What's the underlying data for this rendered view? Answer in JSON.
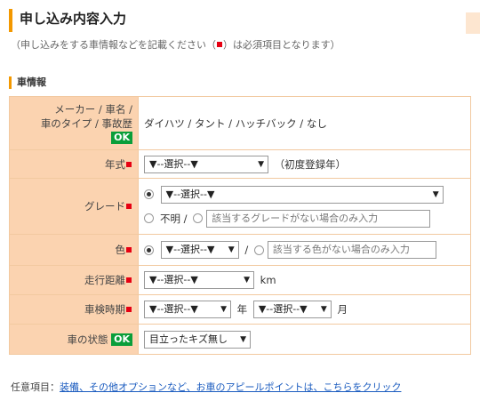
{
  "header": {
    "title": "申し込み内容入力",
    "subtitle_before": "（申し込みをする車情報などを記載ください（",
    "subtitle_after": "）は必須項目となります）"
  },
  "section": {
    "title": "車情報"
  },
  "rows": {
    "maker": {
      "label_line1": "メーカー / 車名 /",
      "label_line2": "車のタイプ / 事故歴",
      "ok": "OK",
      "value": "ダイハツ / タント / ハッチバック / なし"
    },
    "year": {
      "label": "年式",
      "select": "▼--選択--▼",
      "note": "（初度登録年）"
    },
    "grade": {
      "label": "グレード",
      "select": "▼--選択--▼",
      "unknown": "不明 /",
      "placeholder": "該当するグレードがない場合のみ入力"
    },
    "color": {
      "label": "色",
      "select": "▼--選択--▼",
      "slash": "/",
      "placeholder": "該当する色がない場合のみ入力"
    },
    "mileage": {
      "label": "走行距離",
      "select": "▼--選択--▼",
      "unit": "km"
    },
    "inspection": {
      "label": "車検時期",
      "year_select": "▼--選択--▼",
      "year_unit": "年",
      "month_select": "▼--選択--▼",
      "month_unit": "月"
    },
    "condition": {
      "label": "車の状態",
      "ok": "OK",
      "select": "目立ったキズ無し"
    }
  },
  "footer": {
    "prefix": "任意項目：",
    "link": "装備、その他オプションなど、お車のアピールポイントは、こちらをクリック"
  },
  "colors": {
    "label_bg": "#fbd3b0",
    "accent": "#f39800",
    "required": "#e60012",
    "ok": "#0a9e3a",
    "link": "#1a5bbf"
  }
}
